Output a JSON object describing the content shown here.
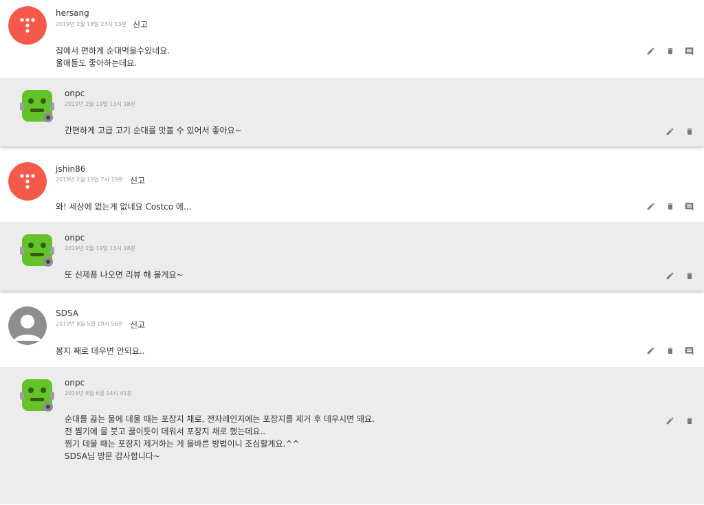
{
  "colors": {
    "reply_bg": "#ececec",
    "avatar_red": "#f4594c",
    "avatar_gray": "#8e8e8e",
    "robot_green": "#66c229",
    "icon_gray": "#7a7a7a"
  },
  "threads": [
    {
      "comment": {
        "author": "hersang",
        "timestamp": "2019년 2월 18일 23시 13분",
        "report_label": "신고",
        "text": "집에서 편하게 순대먹을수있네요.\n울애들도 좋아하는데요.",
        "avatar": "tistory-avatar-red"
      },
      "reply": {
        "author": "onpc",
        "timestamp": "2019년 2월 19일 13시 18분",
        "text": "간편하게 고급 고기 순대를 맛볼 수 있어서 좋아요~",
        "avatar": "green-robot-avatar"
      }
    },
    {
      "comment": {
        "author": "jshin86",
        "timestamp": "2019년 2월 19일 7시 19분",
        "report_label": "신고",
        "text": "와! 세상에 없는게 없네요 Costco 에...",
        "avatar": "tistory-avatar-red"
      },
      "reply": {
        "author": "onpc",
        "timestamp": "2019년 2월 19일 13시 18분",
        "text": "또 신제품 나오면 리뷰 해 볼게요~",
        "avatar": "green-robot-avatar"
      }
    },
    {
      "comment": {
        "author": "SDSA",
        "timestamp": "2019년 8월 5일 19시 56분",
        "report_label": "신고",
        "text": "봉지 째로 데우면 안되요..",
        "avatar": "default-user-avatar"
      },
      "reply": {
        "author": "onpc",
        "timestamp": "2019년 8월 6일 14시 41분",
        "text": "순대를 끓는 물에 데울 때는 포장지 채로, 전자레인지에는 포장지를 제거 후 데우시면 돼요.\n전 찜기에 물 붓고 끓이듯이 데워서 포장지 채로 했는데요..\n찜기 데울 때는 포장지 제거하는 게 올바른 방법이니 조심할게요.^^\nSDSA님 방문 감사합니다~",
        "avatar": "green-robot-avatar"
      }
    }
  ]
}
